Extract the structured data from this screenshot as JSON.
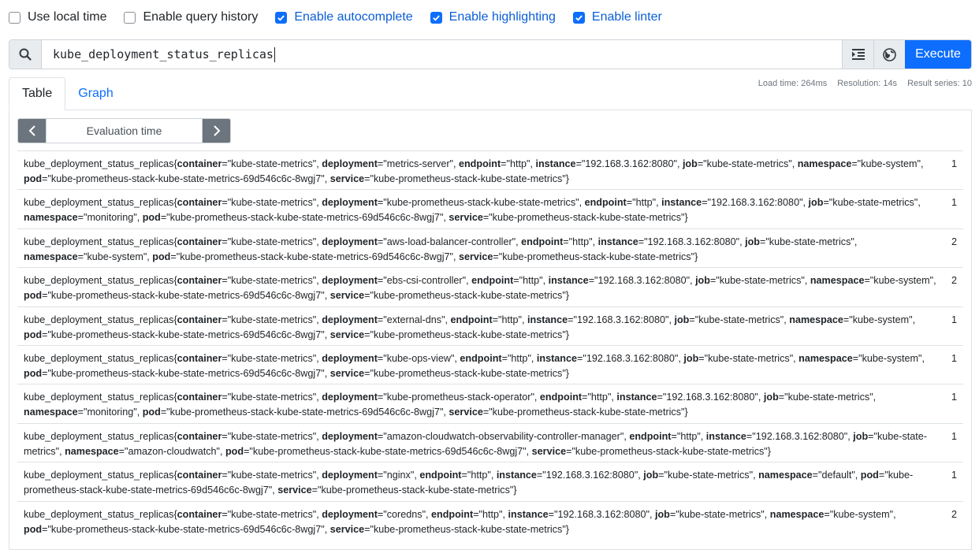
{
  "options": [
    {
      "label": "Use local time",
      "checked": false
    },
    {
      "label": "Enable query history",
      "checked": false
    },
    {
      "label": "Enable autocomplete",
      "checked": true
    },
    {
      "label": "Enable highlighting",
      "checked": true
    },
    {
      "label": "Enable linter",
      "checked": true
    }
  ],
  "query": {
    "value": "kube_deployment_status_replicas",
    "search_icon": "search-icon",
    "format_icon": "format-indent-icon",
    "explore_icon": "globe-icon",
    "execute_label": "Execute"
  },
  "stats": {
    "load_time": "Load time: 264ms",
    "resolution": "Resolution: 14s",
    "result_series": "Result series: 10"
  },
  "tabs": [
    {
      "label": "Table",
      "active": true
    },
    {
      "label": "Graph",
      "active": false
    }
  ],
  "eval": {
    "placeholder": "Evaluation time",
    "prev_icon": "chevron-left-icon",
    "next_icon": "chevron-right-icon"
  },
  "colors": {
    "accent": "#0d6efd",
    "secondary": "#6c757d"
  },
  "results": [
    {
      "name": "kube_deployment_status_replicas",
      "labels": [
        [
          "container",
          "kube-state-metrics"
        ],
        [
          "deployment",
          "metrics-server"
        ],
        [
          "endpoint",
          "http"
        ],
        [
          "instance",
          "192.168.3.162:8080"
        ],
        [
          "job",
          "kube-state-metrics"
        ],
        [
          "namespace",
          "kube-system"
        ],
        [
          "pod",
          "kube-prometheus-stack-kube-state-metrics-69d546c6c-8wgj7"
        ],
        [
          "service",
          "kube-prometheus-stack-kube-state-metrics"
        ]
      ],
      "value": "1"
    },
    {
      "name": "kube_deployment_status_replicas",
      "labels": [
        [
          "container",
          "kube-state-metrics"
        ],
        [
          "deployment",
          "kube-prometheus-stack-kube-state-metrics"
        ],
        [
          "endpoint",
          "http"
        ],
        [
          "instance",
          "192.168.3.162:8080"
        ],
        [
          "job",
          "kube-state-metrics"
        ],
        [
          "namespace",
          "monitoring"
        ],
        [
          "pod",
          "kube-prometheus-stack-kube-state-metrics-69d546c6c-8wgj7"
        ],
        [
          "service",
          "kube-prometheus-stack-kube-state-metrics"
        ]
      ],
      "value": "1"
    },
    {
      "name": "kube_deployment_status_replicas",
      "labels": [
        [
          "container",
          "kube-state-metrics"
        ],
        [
          "deployment",
          "aws-load-balancer-controller"
        ],
        [
          "endpoint",
          "http"
        ],
        [
          "instance",
          "192.168.3.162:8080"
        ],
        [
          "job",
          "kube-state-metrics"
        ],
        [
          "namespace",
          "kube-system"
        ],
        [
          "pod",
          "kube-prometheus-stack-kube-state-metrics-69d546c6c-8wgj7"
        ],
        [
          "service",
          "kube-prometheus-stack-kube-state-metrics"
        ]
      ],
      "value": "2"
    },
    {
      "name": "kube_deployment_status_replicas",
      "labels": [
        [
          "container",
          "kube-state-metrics"
        ],
        [
          "deployment",
          "ebs-csi-controller"
        ],
        [
          "endpoint",
          "http"
        ],
        [
          "instance",
          "192.168.3.162:8080"
        ],
        [
          "job",
          "kube-state-metrics"
        ],
        [
          "namespace",
          "kube-system"
        ],
        [
          "pod",
          "kube-prometheus-stack-kube-state-metrics-69d546c6c-8wgj7"
        ],
        [
          "service",
          "kube-prometheus-stack-kube-state-metrics"
        ]
      ],
      "value": "2"
    },
    {
      "name": "kube_deployment_status_replicas",
      "labels": [
        [
          "container",
          "kube-state-metrics"
        ],
        [
          "deployment",
          "external-dns"
        ],
        [
          "endpoint",
          "http"
        ],
        [
          "instance",
          "192.168.3.162:8080"
        ],
        [
          "job",
          "kube-state-metrics"
        ],
        [
          "namespace",
          "kube-system"
        ],
        [
          "pod",
          "kube-prometheus-stack-kube-state-metrics-69d546c6c-8wgj7"
        ],
        [
          "service",
          "kube-prometheus-stack-kube-state-metrics"
        ]
      ],
      "value": "1"
    },
    {
      "name": "kube_deployment_status_replicas",
      "labels": [
        [
          "container",
          "kube-state-metrics"
        ],
        [
          "deployment",
          "kube-ops-view"
        ],
        [
          "endpoint",
          "http"
        ],
        [
          "instance",
          "192.168.3.162:8080"
        ],
        [
          "job",
          "kube-state-metrics"
        ],
        [
          "namespace",
          "kube-system"
        ],
        [
          "pod",
          "kube-prometheus-stack-kube-state-metrics-69d546c6c-8wgj7"
        ],
        [
          "service",
          "kube-prometheus-stack-kube-state-metrics"
        ]
      ],
      "value": "1"
    },
    {
      "name": "kube_deployment_status_replicas",
      "labels": [
        [
          "container",
          "kube-state-metrics"
        ],
        [
          "deployment",
          "kube-prometheus-stack-operator"
        ],
        [
          "endpoint",
          "http"
        ],
        [
          "instance",
          "192.168.3.162:8080"
        ],
        [
          "job",
          "kube-state-metrics"
        ],
        [
          "namespace",
          "monitoring"
        ],
        [
          "pod",
          "kube-prometheus-stack-kube-state-metrics-69d546c6c-8wgj7"
        ],
        [
          "service",
          "kube-prometheus-stack-kube-state-metrics"
        ]
      ],
      "value": "1"
    },
    {
      "name": "kube_deployment_status_replicas",
      "labels": [
        [
          "container",
          "kube-state-metrics"
        ],
        [
          "deployment",
          "amazon-cloudwatch-observability-controller-manager"
        ],
        [
          "endpoint",
          "http"
        ],
        [
          "instance",
          "192.168.3.162:8080"
        ],
        [
          "job",
          "kube-state-metrics"
        ],
        [
          "namespace",
          "amazon-cloudwatch"
        ],
        [
          "pod",
          "kube-prometheus-stack-kube-state-metrics-69d546c6c-8wgj7"
        ],
        [
          "service",
          "kube-prometheus-stack-kube-state-metrics"
        ]
      ],
      "value": "1"
    },
    {
      "name": "kube_deployment_status_replicas",
      "labels": [
        [
          "container",
          "kube-state-metrics"
        ],
        [
          "deployment",
          "nginx"
        ],
        [
          "endpoint",
          "http"
        ],
        [
          "instance",
          "192.168.3.162:8080"
        ],
        [
          "job",
          "kube-state-metrics"
        ],
        [
          "namespace",
          "default"
        ],
        [
          "pod",
          "kube-prometheus-stack-kube-state-metrics-69d546c6c-8wgj7"
        ],
        [
          "service",
          "kube-prometheus-stack-kube-state-metrics"
        ]
      ],
      "value": "1"
    },
    {
      "name": "kube_deployment_status_replicas",
      "labels": [
        [
          "container",
          "kube-state-metrics"
        ],
        [
          "deployment",
          "coredns"
        ],
        [
          "endpoint",
          "http"
        ],
        [
          "instance",
          "192.168.3.162:8080"
        ],
        [
          "job",
          "kube-state-metrics"
        ],
        [
          "namespace",
          "kube-system"
        ],
        [
          "pod",
          "kube-prometheus-stack-kube-state-metrics-69d546c6c-8wgj7"
        ],
        [
          "service",
          "kube-prometheus-stack-kube-state-metrics"
        ]
      ],
      "value": "2"
    }
  ]
}
